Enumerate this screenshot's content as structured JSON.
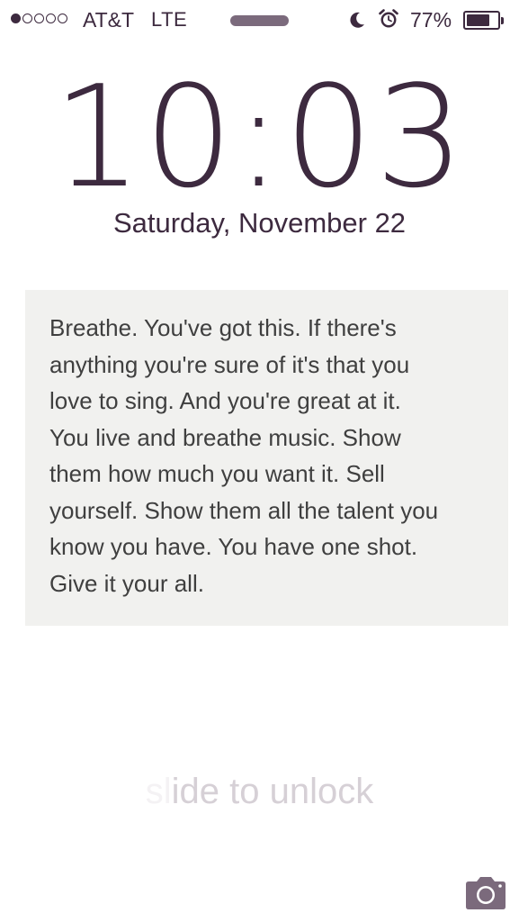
{
  "status_bar": {
    "signal_bars_filled": 1,
    "signal_bars_total": 5,
    "carrier": "AT&T",
    "network": "LTE",
    "do_not_disturb_icon": "moon-icon",
    "alarm_icon": "alarm-clock-icon",
    "battery_percent_label": "77%",
    "battery_level": 0.77
  },
  "lock_screen": {
    "time": "10:03",
    "date": "Saturday, November 22",
    "unlock_hint": "slide to unlock",
    "camera_icon": "camera-icon"
  },
  "wallpaper": {
    "note_lines": [
      "Breathe. You've got this. If there's",
      "anything you're sure of it's that you",
      "love to sing. And you're great at it.",
      "You live and breathe music. Show",
      "them how much you want it. Sell",
      "yourself. Show them all the talent you",
      "know you have. You have one shot.",
      "Give it your all."
    ]
  },
  "colors": {
    "accent": "#3d2a3f",
    "note_background": "#f1f1ef",
    "unlock_text": "#d6d0d6"
  }
}
